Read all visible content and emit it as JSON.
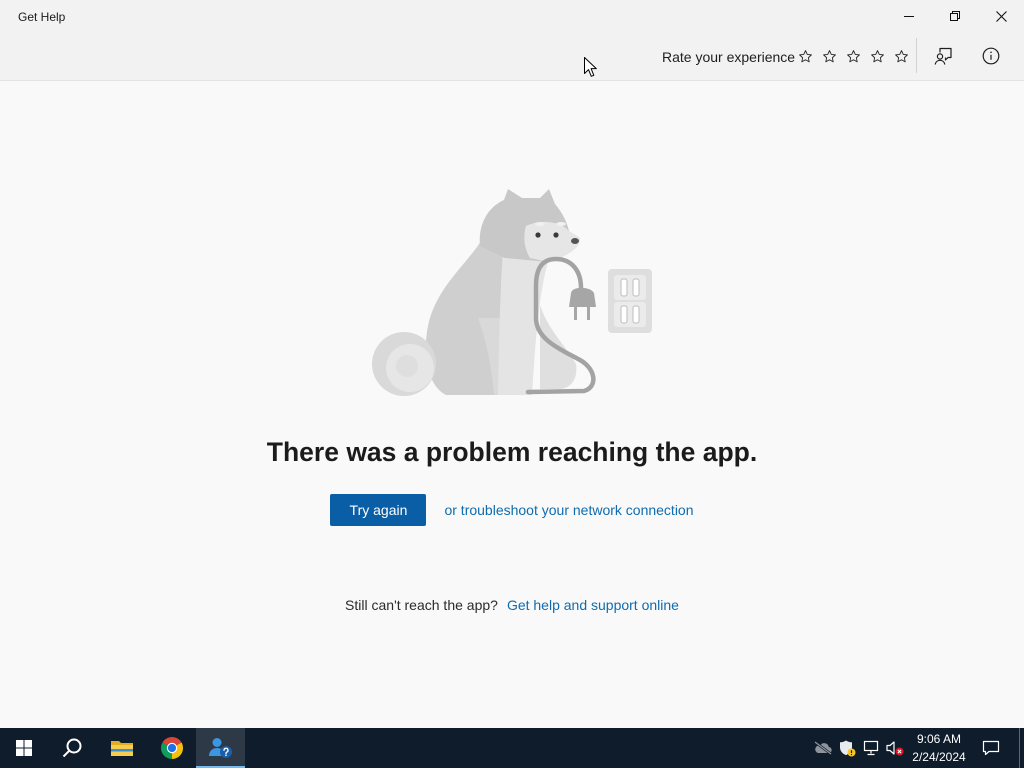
{
  "colors": {
    "chrome_bg": "#f2f2f2",
    "content_bg": "#f9f9f9",
    "accent": "#0a5ea6",
    "link": "#0f6cb0",
    "taskbar_bg": "#0f1c2c",
    "taskbar_active": "#76b9ed"
  },
  "window": {
    "title": "Get Help",
    "controls": [
      "minimize-icon",
      "restore-icon",
      "close-icon"
    ]
  },
  "toolbar": {
    "rating_label": "Rate your experience",
    "rating": {
      "value": 0,
      "max": 5
    },
    "feedback_icon": "feedback-icon",
    "info_icon": "info-icon"
  },
  "error": {
    "heading": "There was a problem reaching the app.",
    "retry_button": "Try again",
    "troubleshoot_link": "or troubleshoot your network connection",
    "fallback_prompt": "Still can't reach the app?",
    "support_link": "Get help and support online"
  },
  "taskbar": {
    "start_icon": "windows-start-icon",
    "search_icon": "search-icon",
    "pinned_apps": [
      {
        "icon": "file-explorer-icon",
        "active": false
      },
      {
        "icon": "chrome-icon",
        "active": false
      },
      {
        "icon": "get-help-icon",
        "active": true
      }
    ],
    "tray_icons": [
      "onedrive-offline-icon",
      "security-warning-icon",
      "network-icon",
      "volume-muted-icon"
    ],
    "clock": {
      "time": "9:06 AM",
      "date": "2/24/2024"
    },
    "notification_icon": "action-center-icon"
  }
}
